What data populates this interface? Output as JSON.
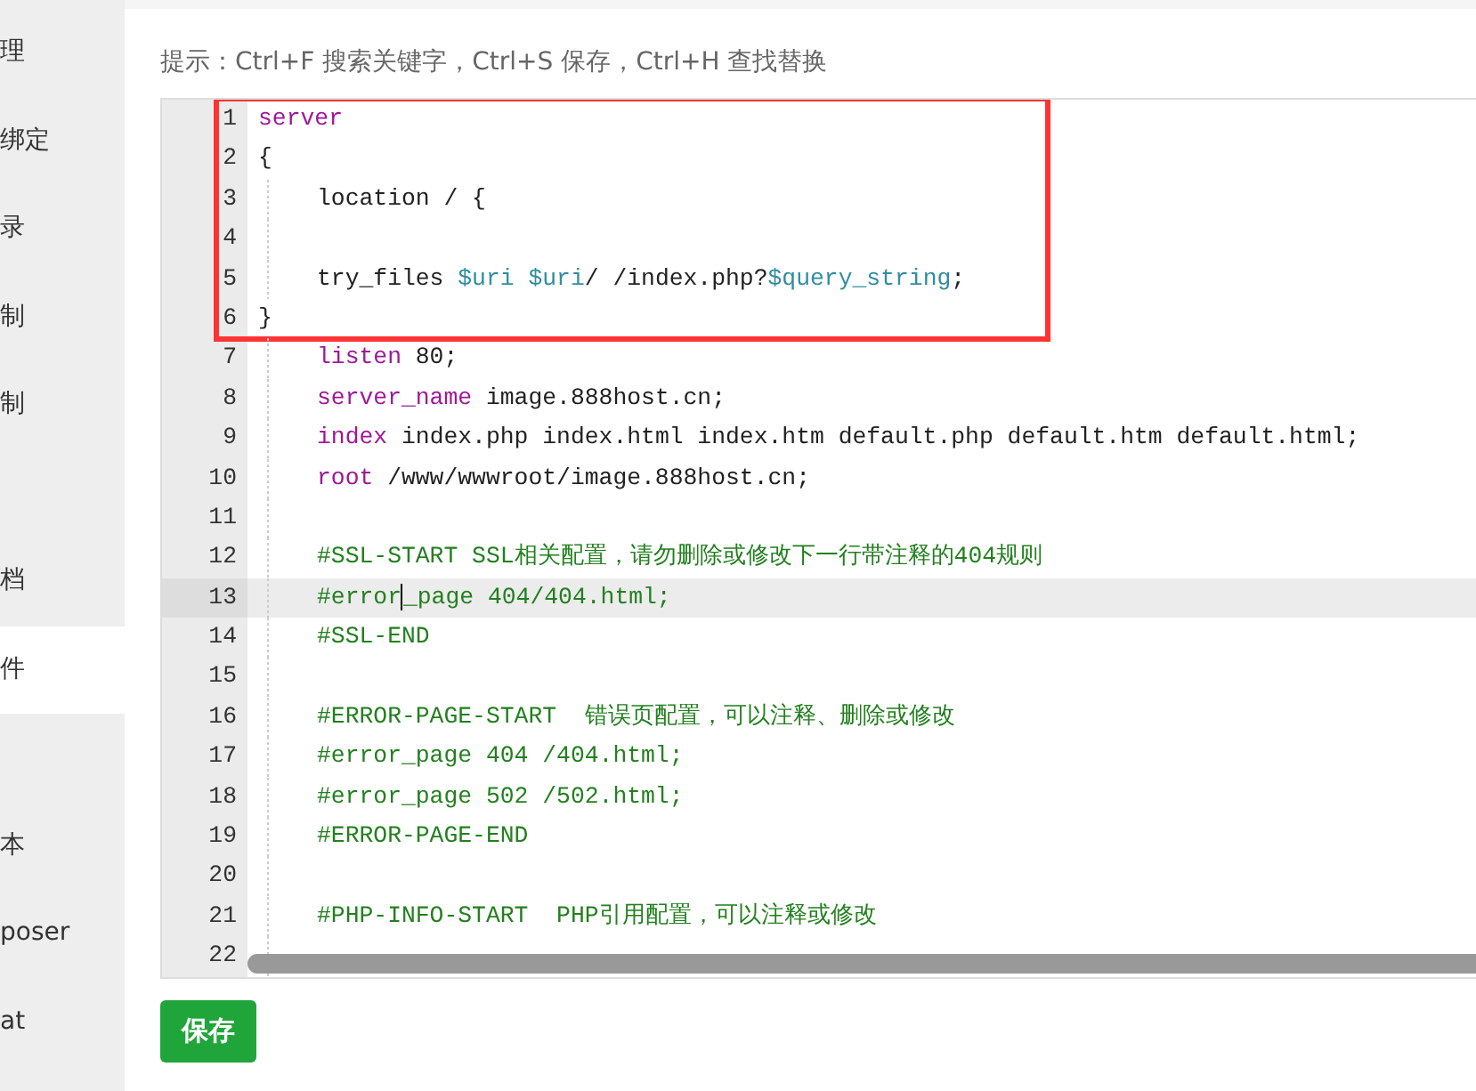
{
  "sidebar": {
    "items": [
      {
        "label": "理",
        "selected": false
      },
      {
        "label": "绑定",
        "selected": false
      },
      {
        "label": "录",
        "selected": false
      },
      {
        "label": "制",
        "selected": false
      },
      {
        "label": "制",
        "selected": false
      },
      {
        "selected": false
      },
      {
        "label": "档",
        "selected": false
      },
      {
        "label": "件",
        "selected": true
      },
      {
        "selected": false
      },
      {
        "label": "本",
        "selected": false
      },
      {
        "label": "poser",
        "selected": false
      },
      {
        "label": "at",
        "selected": false
      }
    ]
  },
  "hint": "提示：Ctrl+F 搜索关键字，Ctrl+S 保存，Ctrl+H 查找替换",
  "editor": {
    "blocks": [
      {
        "boxed": true,
        "color": "#ff3333",
        "lines": [
          {
            "number": "1",
            "indent": false,
            "active": false,
            "tokens": [
              {
                "kind": "keyword",
                "text": "server"
              }
            ]
          },
          {
            "number": "2",
            "indent": false,
            "active": false,
            "tokens": [
              {
                "kind": "plain",
                "text": "{"
              }
            ]
          },
          {
            "number": "3",
            "indent": true,
            "active": false,
            "tokens": [
              {
                "kind": "plain",
                "text": "location / {"
              }
            ]
          },
          {
            "number": "4",
            "indent": true,
            "active": false
          },
          {
            "number": "5",
            "indent": true,
            "active": false,
            "tokens": [
              {
                "kind": "plain",
                "text": "try_files "
              },
              {
                "kind": "variable",
                "text": "$uri $uri"
              },
              {
                "kind": "plain",
                "text": "/ /index.php?"
              },
              {
                "kind": "variable",
                "text": "$query_string"
              },
              {
                "kind": "plain",
                "text": ";"
              }
            ]
          },
          {
            "number": "6",
            "indent": false,
            "active": false,
            "tokens": [
              {
                "kind": "plain",
                "text": "}"
              }
            ]
          }
        ]
      },
      {
        "boxed": false,
        "lines": [
          {
            "number": "7",
            "indent": true,
            "active": false,
            "tokens": [
              {
                "kind": "keyword",
                "text": "listen"
              },
              {
                "kind": "plain",
                "text": " 80;"
              }
            ]
          },
          {
            "number": "8",
            "indent": true,
            "active": false,
            "tokens": [
              {
                "kind": "keyword",
                "text": "server_name"
              },
              {
                "kind": "plain",
                "text": " image.888host.cn;"
              }
            ]
          },
          {
            "number": "9",
            "indent": true,
            "active": false,
            "tokens": [
              {
                "kind": "keyword",
                "text": "index"
              },
              {
                "kind": "plain",
                "text": " index.php index.html index.htm default.php default.htm default.html;"
              }
            ]
          },
          {
            "number": "10",
            "indent": true,
            "active": false,
            "tokens": [
              {
                "kind": "keyword",
                "text": "root"
              },
              {
                "kind": "plain",
                "text": " /www/wwwroot/image.888host.cn;"
              }
            ]
          },
          {
            "number": "11",
            "indent": true,
            "active": false
          },
          {
            "number": "12",
            "indent": true,
            "active": false,
            "tokens": [
              {
                "kind": "comment",
                "text": "#SSL-START SSL相关配置，请勿删除或修改下一行带注释的404规则"
              }
            ]
          },
          {
            "number": "13",
            "indent": true,
            "active": true,
            "tokens": [
              {
                "kind": "comment",
                "text": "#error",
                "caret_after": true
              },
              {
                "kind": "comment",
                "text": "_page 404/404.html;"
              }
            ]
          },
          {
            "number": "14",
            "indent": true,
            "active": false,
            "tokens": [
              {
                "kind": "comment",
                "text": "#SSL-END"
              }
            ]
          },
          {
            "number": "15",
            "indent": true,
            "active": false
          },
          {
            "number": "16",
            "indent": true,
            "active": false,
            "tokens": [
              {
                "kind": "comment",
                "text": "#ERROR-PAGE-START  错误页配置，可以注释、删除或修改"
              }
            ]
          },
          {
            "number": "17",
            "indent": true,
            "active": false,
            "tokens": [
              {
                "kind": "comment",
                "text": "#error_page 404 /404.html;"
              }
            ]
          },
          {
            "number": "18",
            "indent": true,
            "active": false,
            "tokens": [
              {
                "kind": "comment",
                "text": "#error_page 502 /502.html;"
              }
            ]
          },
          {
            "number": "19",
            "indent": true,
            "active": false,
            "tokens": [
              {
                "kind": "comment",
                "text": "#ERROR-PAGE-END"
              }
            ]
          },
          {
            "number": "20",
            "indent": true,
            "active": false
          },
          {
            "number": "21",
            "indent": true,
            "active": false,
            "tokens": [
              {
                "kind": "comment",
                "text": "#PHP-INFO-START  PHP引用配置，可以注释或修改"
              }
            ]
          },
          {
            "number": "22",
            "indent": true,
            "active": false
          }
        ]
      }
    ]
  },
  "save_button": "保存"
}
